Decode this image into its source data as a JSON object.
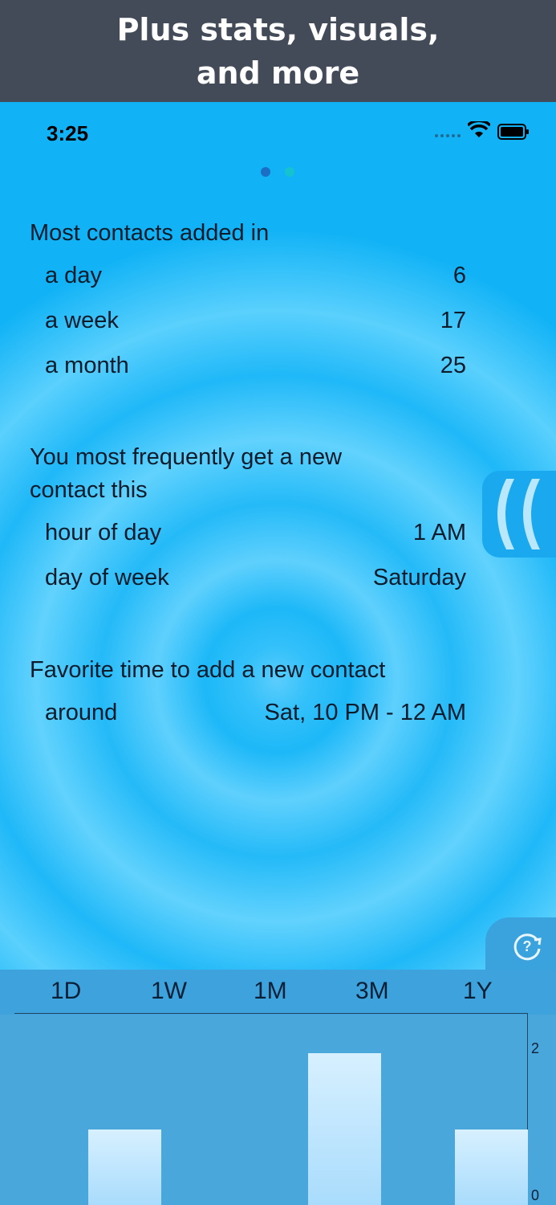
{
  "banner": {
    "line1": "Plus stats, visuals,",
    "line2": "and more"
  },
  "status": {
    "time": "3:25",
    "signal_icon": "signal-dots-icon",
    "wifi_icon": "wifi-icon",
    "battery_icon": "battery-icon"
  },
  "pager": {
    "pages": 2,
    "active": 0
  },
  "most_added": {
    "title": "Most contacts added in",
    "rows": [
      {
        "label": "a day",
        "value": "6"
      },
      {
        "label": "a week",
        "value": "17"
      },
      {
        "label": "a month",
        "value": "25"
      }
    ]
  },
  "frequent": {
    "title_line1": "You most frequently get a new",
    "title_line2": "contact this",
    "rows": [
      {
        "label": "hour of day",
        "value": "1 AM"
      },
      {
        "label": "day of week",
        "value": "Saturday"
      }
    ]
  },
  "favorite": {
    "title": "Favorite time to add a new contact",
    "rows": [
      {
        "label": "around",
        "value": "Sat, 10 PM - 12 AM"
      }
    ]
  },
  "ranges": [
    "1D",
    "1W",
    "1M",
    "3M",
    "1Y"
  ],
  "chart_data": {
    "type": "bar",
    "values": [
      1,
      2,
      1
    ],
    "y_ticks": [
      "2",
      "0"
    ],
    "ylim": [
      0,
      2
    ]
  },
  "colors": {
    "accent": "#12b4f7",
    "banner": "#434a58",
    "bar_top": "#d7f0ff"
  }
}
